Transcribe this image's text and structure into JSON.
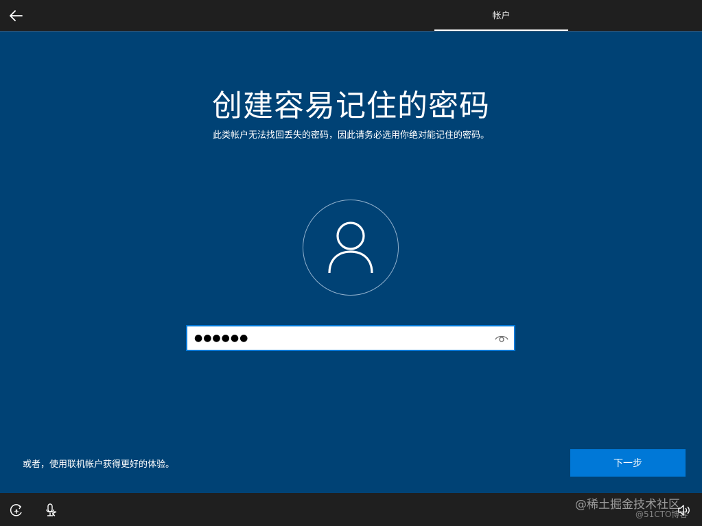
{
  "header": {
    "tab_label": "帐户"
  },
  "main": {
    "title": "创建容易记住的密码",
    "subtitle": "此类帐户无法找回丢失的密码，因此请务必选用你绝对能记住的密码。",
    "password_value": "●●●●●●",
    "online_account_link": "或者，使用联机帐户获得更好的体验。",
    "next_label": "下一步"
  },
  "footer": {
    "watermark": "@稀土掘金技术社区",
    "watermark_sub": "@51CTO博客"
  },
  "icons": {
    "back": "arrow-left-icon",
    "avatar": "user-icon",
    "reveal": "eye-icon",
    "accessibility": "ease-of-access-icon",
    "microphone": "microphone-icon",
    "volume": "volume-icon"
  },
  "colors": {
    "background": "#004275",
    "bar": "#1f1f1f",
    "accent": "#0078d7"
  }
}
